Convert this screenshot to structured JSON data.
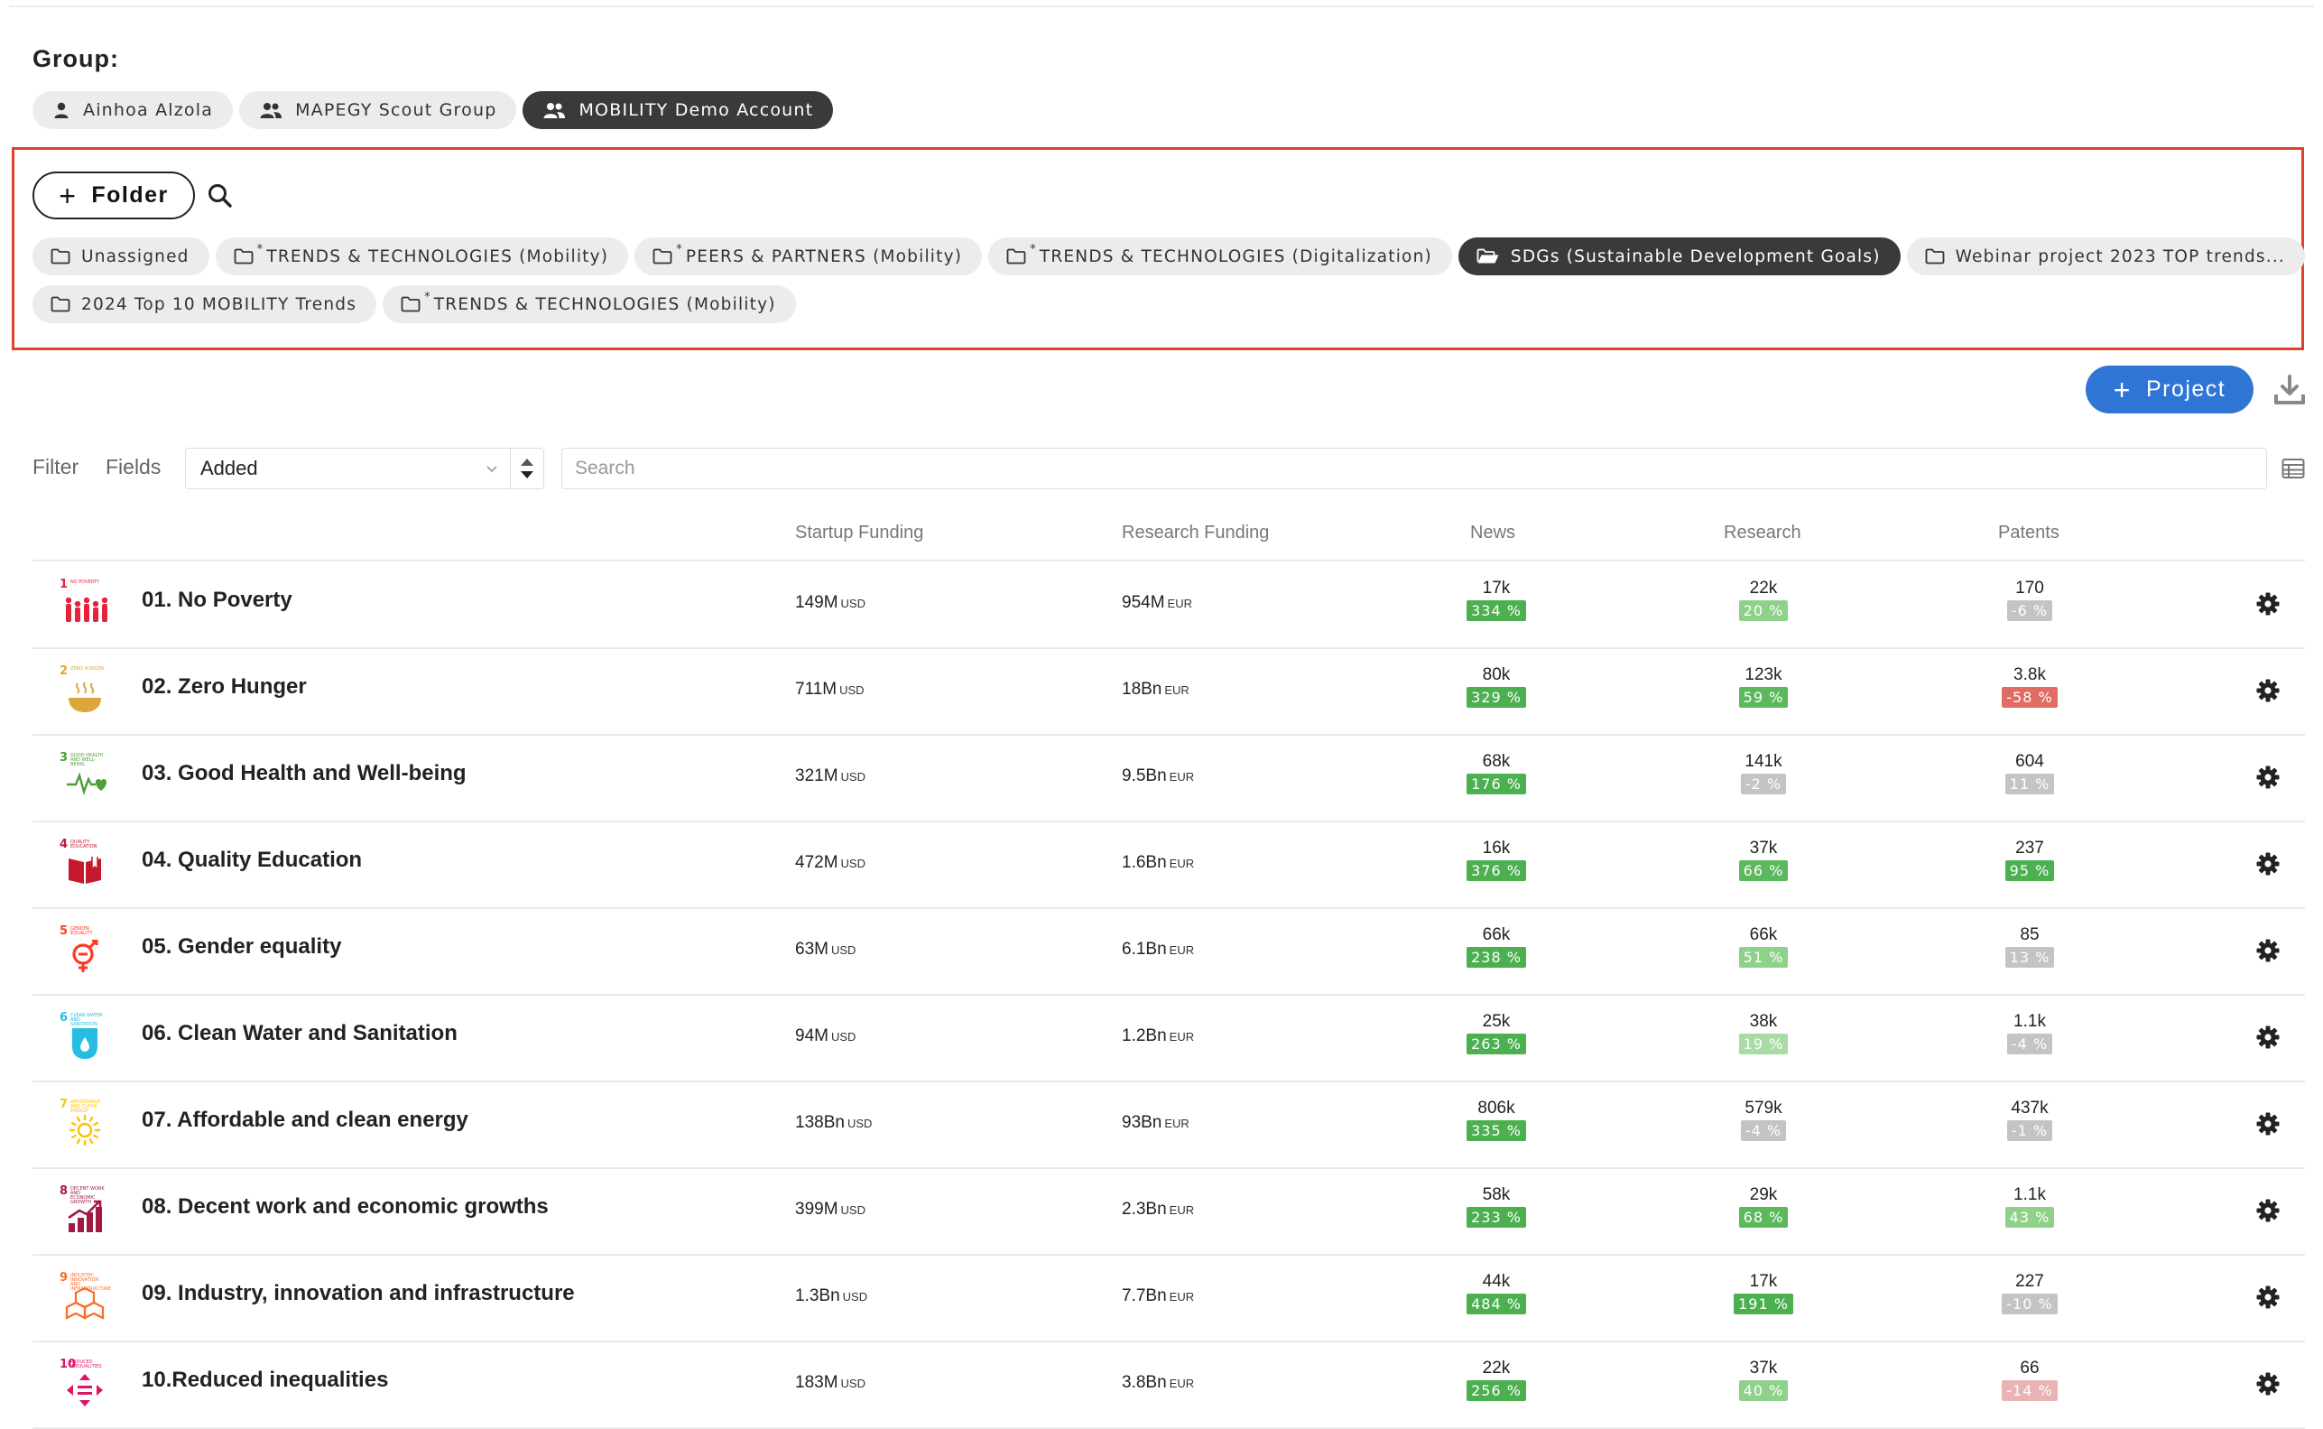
{
  "group": {
    "label": "Group:",
    "chips": [
      {
        "label": "Ainhoa Alzola",
        "icon": "user-icon",
        "active": false
      },
      {
        "label": "MAPEGY Scout Group",
        "icon": "users-icon",
        "active": false
      },
      {
        "label": "MOBILITY Demo Account",
        "icon": "users-icon",
        "active": true
      }
    ]
  },
  "folders": {
    "add_label": "Folder",
    "row1": [
      {
        "label": "Unassigned",
        "star": false,
        "active": false
      },
      {
        "label": "TRENDS & TECHNOLOGIES (Mobility)",
        "star": true,
        "active": false
      },
      {
        "label": "PEERS & PARTNERS (Mobility)",
        "star": true,
        "active": false
      },
      {
        "label": "TRENDS & TECHNOLOGIES (Digitalization)",
        "star": true,
        "active": false
      },
      {
        "label": "SDGs (Sustainable Development Goals)",
        "star": false,
        "active": true
      },
      {
        "label": "Webinar project 2023 TOP trends...",
        "star": false,
        "active": false
      }
    ],
    "row2": [
      {
        "label": "2024 Top 10 MOBILITY Trends",
        "star": false,
        "active": false
      },
      {
        "label": "TRENDS & TECHNOLOGIES (Mobility)",
        "star": true,
        "active": false
      }
    ]
  },
  "toolbar": {
    "project_label": "Project",
    "filter_label": "Filter",
    "fields_label": "Fields",
    "sort_value": "Added",
    "search_placeholder": "Search"
  },
  "columns": {
    "startup_funding": "Startup Funding",
    "research_funding": "Research Funding",
    "news": "News",
    "research": "Research",
    "patents": "Patents"
  },
  "colors": {
    "accent": "#2f75d6",
    "highlight_box": "#e0412f",
    "badge_green": "#4caf50",
    "badge_light_green": "#8fd18a",
    "badge_gray": "#c4c4c4",
    "badge_red": "#e06c63",
    "badge_light_red": "#e8b4b4"
  },
  "rows": [
    {
      "num": "1",
      "mini": "NO POVERTY",
      "color": "#e5243b",
      "icon": "family-icon",
      "name": "01. No Poverty",
      "sf": "149M",
      "sf_unit": "USD",
      "rf": "954M",
      "rf_unit": "EUR",
      "news": "17k",
      "news_pct": "334 %",
      "news_c": "#4caf50",
      "research": "22k",
      "research_pct": "20 %",
      "research_c": "#8fd18a",
      "patents": "170",
      "patents_pct": "-6 %",
      "patents_c": "#c4c4c4"
    },
    {
      "num": "2",
      "mini": "ZERO HUNGER",
      "color": "#dda63a",
      "icon": "bowl-icon",
      "name": "02. Zero Hunger",
      "sf": "711M",
      "sf_unit": "USD",
      "rf": "18Bn",
      "rf_unit": "EUR",
      "news": "80k",
      "news_pct": "329 %",
      "news_c": "#4caf50",
      "research": "123k",
      "research_pct": "59 %",
      "research_c": "#5cb85c",
      "patents": "3.8k",
      "patents_pct": "-58 %",
      "patents_c": "#e06c63"
    },
    {
      "num": "3",
      "mini": "GOOD HEALTH AND WELL-BEING",
      "color": "#4c9f38",
      "icon": "heartbeat-icon",
      "name": "03. Good Health and Well-being",
      "sf": "321M",
      "sf_unit": "USD",
      "rf": "9.5Bn",
      "rf_unit": "EUR",
      "news": "68k",
      "news_pct": "176 %",
      "news_c": "#4caf50",
      "research": "141k",
      "research_pct": "-2 %",
      "research_c": "#c4c4c4",
      "patents": "604",
      "patents_pct": "11 %",
      "patents_c": "#c4c4c4"
    },
    {
      "num": "4",
      "mini": "QUALITY EDUCATION",
      "color": "#c5192d",
      "icon": "book-icon",
      "name": "04. Quality Education",
      "sf": "472M",
      "sf_unit": "USD",
      "rf": "1.6Bn",
      "rf_unit": "EUR",
      "news": "16k",
      "news_pct": "376 %",
      "news_c": "#4caf50",
      "research": "37k",
      "research_pct": "66 %",
      "research_c": "#5cb85c",
      "patents": "237",
      "patents_pct": "95 %",
      "patents_c": "#4caf50"
    },
    {
      "num": "5",
      "mini": "GENDER EQUALITY",
      "color": "#ff3a21",
      "icon": "gender-icon",
      "name": "05. Gender equality",
      "sf": "63M",
      "sf_unit": "USD",
      "rf": "6.1Bn",
      "rf_unit": "EUR",
      "news": "66k",
      "news_pct": "238 %",
      "news_c": "#4caf50",
      "research": "66k",
      "research_pct": "51 %",
      "research_c": "#8fd18a",
      "patents": "85",
      "patents_pct": "13 %",
      "patents_c": "#c4c4c4"
    },
    {
      "num": "6",
      "mini": "CLEAN WATER AND SANITATION",
      "color": "#26bde2",
      "icon": "water-icon",
      "name": "06. Clean Water and Sanitation",
      "sf": "94M",
      "sf_unit": "USD",
      "rf": "1.2Bn",
      "rf_unit": "EUR",
      "news": "25k",
      "news_pct": "263 %",
      "news_c": "#4caf50",
      "research": "38k",
      "research_pct": "19 %",
      "research_c": "#a8dca4",
      "patents": "1.1k",
      "patents_pct": "-4 %",
      "patents_c": "#c4c4c4"
    },
    {
      "num": "7",
      "mini": "AFFORDABLE AND CLEAN ENERGY",
      "color": "#fcc30b",
      "icon": "sun-icon",
      "name": "07. Affordable and clean energy",
      "sf": "138Bn",
      "sf_unit": "USD",
      "rf": "93Bn",
      "rf_unit": "EUR",
      "news": "806k",
      "news_pct": "335 %",
      "news_c": "#4caf50",
      "research": "579k",
      "research_pct": "-4 %",
      "research_c": "#c4c4c4",
      "patents": "437k",
      "patents_pct": "-1 %",
      "patents_c": "#c4c4c4"
    },
    {
      "num": "8",
      "mini": "DECENT WORK AND ECONOMIC GROWTH",
      "color": "#a21942",
      "icon": "growth-chart-icon",
      "name": "08. Decent work and economic growths",
      "sf": "399M",
      "sf_unit": "USD",
      "rf": "2.3Bn",
      "rf_unit": "EUR",
      "news": "58k",
      "news_pct": "233 %",
      "news_c": "#4caf50",
      "research": "29k",
      "research_pct": "68 %",
      "research_c": "#5cb85c",
      "patents": "1.1k",
      "patents_pct": "43 %",
      "patents_c": "#8fd18a"
    },
    {
      "num": "9",
      "mini": "INDUSTRY, INNOVATION AND INFRASTRUCTURE",
      "color": "#fd6925",
      "icon": "cubes-icon",
      "name": "09. Industry, innovation and infrastructure",
      "sf": "1.3Bn",
      "sf_unit": "USD",
      "rf": "7.7Bn",
      "rf_unit": "EUR",
      "news": "44k",
      "news_pct": "484 %",
      "news_c": "#4caf50",
      "research": "17k",
      "research_pct": "191 %",
      "research_c": "#4caf50",
      "patents": "227",
      "patents_pct": "-10 %",
      "patents_c": "#c4c4c4"
    },
    {
      "num": "10",
      "mini": "REDUCED INEQUALITIES",
      "color": "#dd1367",
      "icon": "arrows-icon",
      "name": "10.Reduced inequalities",
      "sf": "183M",
      "sf_unit": "USD",
      "rf": "3.8Bn",
      "rf_unit": "EUR",
      "news": "22k",
      "news_pct": "256 %",
      "news_c": "#4caf50",
      "research": "37k",
      "research_pct": "40 %",
      "research_c": "#8fd18a",
      "patents": "66",
      "patents_pct": "-14 %",
      "patents_c": "#e8b4b4"
    }
  ]
}
